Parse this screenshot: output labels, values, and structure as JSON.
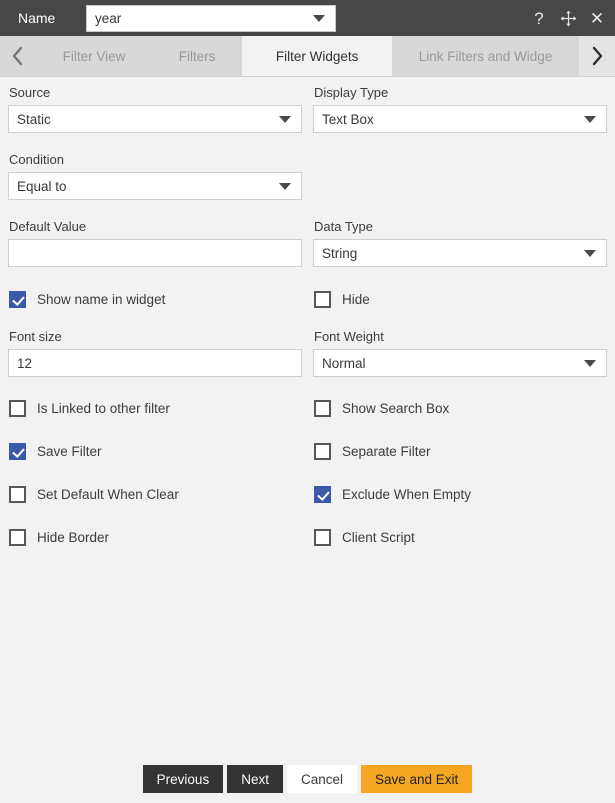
{
  "titlebar": {
    "name_label": "Name",
    "name_value": "year",
    "help_icon": "question-mark-icon",
    "move_icon": "move-arrows-icon",
    "close_icon": "close-icon"
  },
  "tabs": {
    "prev_arrow": "chevron-left-icon",
    "next_arrow": "chevron-right-icon",
    "items": [
      {
        "label": "Filter View",
        "active": false
      },
      {
        "label": "Filters",
        "active": false
      },
      {
        "label": "Filter Widgets",
        "active": true
      },
      {
        "label": "Link Filters and Widge",
        "active": false
      }
    ]
  },
  "form": {
    "source": {
      "label": "Source",
      "value": "Static"
    },
    "display_type": {
      "label": "Display Type",
      "value": "Text Box"
    },
    "condition": {
      "label": "Condition",
      "value": "Equal to"
    },
    "default_value": {
      "label": "Default Value",
      "value": "",
      "placeholder": ""
    },
    "data_type": {
      "label": "Data Type",
      "value": "String"
    },
    "font_size": {
      "label": "Font size",
      "value": "12"
    },
    "font_weight": {
      "label": "Font Weight",
      "value": "Normal"
    },
    "checkboxes_left": [
      {
        "label": "Show name in widget",
        "checked": true
      },
      {
        "label": "Is Linked to other filter",
        "checked": false
      },
      {
        "label": "Save Filter",
        "checked": true
      },
      {
        "label": "Set Default When Clear",
        "checked": false
      },
      {
        "label": "Hide Border",
        "checked": false
      }
    ],
    "checkboxes_right": [
      {
        "label": "Hide",
        "checked": false
      },
      {
        "label": "Show Search Box",
        "checked": false
      },
      {
        "label": "Separate Filter",
        "checked": false
      },
      {
        "label": "Exclude When Empty",
        "checked": true
      },
      {
        "label": "Client Script",
        "checked": false
      }
    ]
  },
  "footer": {
    "previous": "Previous",
    "next": "Next",
    "cancel": "Cancel",
    "save_and_exit": "Save and Exit"
  },
  "colors": {
    "titlebar_bg": "#474747",
    "tabstrip_bg": "#d8d8d8",
    "page_bg": "#f2f2f2",
    "checkbox_checked": "#3a59a8",
    "accent_button": "#f5a623",
    "dark_button": "#333333"
  }
}
